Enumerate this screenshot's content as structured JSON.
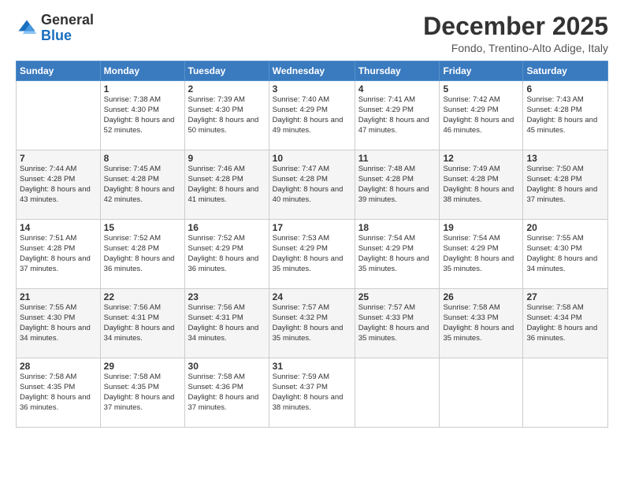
{
  "logo": {
    "general": "General",
    "blue": "Blue"
  },
  "header": {
    "month": "December 2025",
    "location": "Fondo, Trentino-Alto Adige, Italy"
  },
  "days_of_week": [
    "Sunday",
    "Monday",
    "Tuesday",
    "Wednesday",
    "Thursday",
    "Friday",
    "Saturday"
  ],
  "weeks": [
    [
      {
        "day": "",
        "sunrise": "",
        "sunset": "",
        "daylight": ""
      },
      {
        "day": "1",
        "sunrise": "Sunrise: 7:38 AM",
        "sunset": "Sunset: 4:30 PM",
        "daylight": "Daylight: 8 hours and 52 minutes."
      },
      {
        "day": "2",
        "sunrise": "Sunrise: 7:39 AM",
        "sunset": "Sunset: 4:30 PM",
        "daylight": "Daylight: 8 hours and 50 minutes."
      },
      {
        "day": "3",
        "sunrise": "Sunrise: 7:40 AM",
        "sunset": "Sunset: 4:29 PM",
        "daylight": "Daylight: 8 hours and 49 minutes."
      },
      {
        "day": "4",
        "sunrise": "Sunrise: 7:41 AM",
        "sunset": "Sunset: 4:29 PM",
        "daylight": "Daylight: 8 hours and 47 minutes."
      },
      {
        "day": "5",
        "sunrise": "Sunrise: 7:42 AM",
        "sunset": "Sunset: 4:29 PM",
        "daylight": "Daylight: 8 hours and 46 minutes."
      },
      {
        "day": "6",
        "sunrise": "Sunrise: 7:43 AM",
        "sunset": "Sunset: 4:28 PM",
        "daylight": "Daylight: 8 hours and 45 minutes."
      }
    ],
    [
      {
        "day": "7",
        "sunrise": "Sunrise: 7:44 AM",
        "sunset": "Sunset: 4:28 PM",
        "daylight": "Daylight: 8 hours and 43 minutes."
      },
      {
        "day": "8",
        "sunrise": "Sunrise: 7:45 AM",
        "sunset": "Sunset: 4:28 PM",
        "daylight": "Daylight: 8 hours and 42 minutes."
      },
      {
        "day": "9",
        "sunrise": "Sunrise: 7:46 AM",
        "sunset": "Sunset: 4:28 PM",
        "daylight": "Daylight: 8 hours and 41 minutes."
      },
      {
        "day": "10",
        "sunrise": "Sunrise: 7:47 AM",
        "sunset": "Sunset: 4:28 PM",
        "daylight": "Daylight: 8 hours and 40 minutes."
      },
      {
        "day": "11",
        "sunrise": "Sunrise: 7:48 AM",
        "sunset": "Sunset: 4:28 PM",
        "daylight": "Daylight: 8 hours and 39 minutes."
      },
      {
        "day": "12",
        "sunrise": "Sunrise: 7:49 AM",
        "sunset": "Sunset: 4:28 PM",
        "daylight": "Daylight: 8 hours and 38 minutes."
      },
      {
        "day": "13",
        "sunrise": "Sunrise: 7:50 AM",
        "sunset": "Sunset: 4:28 PM",
        "daylight": "Daylight: 8 hours and 37 minutes."
      }
    ],
    [
      {
        "day": "14",
        "sunrise": "Sunrise: 7:51 AM",
        "sunset": "Sunset: 4:28 PM",
        "daylight": "Daylight: 8 hours and 37 minutes."
      },
      {
        "day": "15",
        "sunrise": "Sunrise: 7:52 AM",
        "sunset": "Sunset: 4:28 PM",
        "daylight": "Daylight: 8 hours and 36 minutes."
      },
      {
        "day": "16",
        "sunrise": "Sunrise: 7:52 AM",
        "sunset": "Sunset: 4:29 PM",
        "daylight": "Daylight: 8 hours and 36 minutes."
      },
      {
        "day": "17",
        "sunrise": "Sunrise: 7:53 AM",
        "sunset": "Sunset: 4:29 PM",
        "daylight": "Daylight: 8 hours and 35 minutes."
      },
      {
        "day": "18",
        "sunrise": "Sunrise: 7:54 AM",
        "sunset": "Sunset: 4:29 PM",
        "daylight": "Daylight: 8 hours and 35 minutes."
      },
      {
        "day": "19",
        "sunrise": "Sunrise: 7:54 AM",
        "sunset": "Sunset: 4:29 PM",
        "daylight": "Daylight: 8 hours and 35 minutes."
      },
      {
        "day": "20",
        "sunrise": "Sunrise: 7:55 AM",
        "sunset": "Sunset: 4:30 PM",
        "daylight": "Daylight: 8 hours and 34 minutes."
      }
    ],
    [
      {
        "day": "21",
        "sunrise": "Sunrise: 7:55 AM",
        "sunset": "Sunset: 4:30 PM",
        "daylight": "Daylight: 8 hours and 34 minutes."
      },
      {
        "day": "22",
        "sunrise": "Sunrise: 7:56 AM",
        "sunset": "Sunset: 4:31 PM",
        "daylight": "Daylight: 8 hours and 34 minutes."
      },
      {
        "day": "23",
        "sunrise": "Sunrise: 7:56 AM",
        "sunset": "Sunset: 4:31 PM",
        "daylight": "Daylight: 8 hours and 34 minutes."
      },
      {
        "day": "24",
        "sunrise": "Sunrise: 7:57 AM",
        "sunset": "Sunset: 4:32 PM",
        "daylight": "Daylight: 8 hours and 35 minutes."
      },
      {
        "day": "25",
        "sunrise": "Sunrise: 7:57 AM",
        "sunset": "Sunset: 4:33 PM",
        "daylight": "Daylight: 8 hours and 35 minutes."
      },
      {
        "day": "26",
        "sunrise": "Sunrise: 7:58 AM",
        "sunset": "Sunset: 4:33 PM",
        "daylight": "Daylight: 8 hours and 35 minutes."
      },
      {
        "day": "27",
        "sunrise": "Sunrise: 7:58 AM",
        "sunset": "Sunset: 4:34 PM",
        "daylight": "Daylight: 8 hours and 36 minutes."
      }
    ],
    [
      {
        "day": "28",
        "sunrise": "Sunrise: 7:58 AM",
        "sunset": "Sunset: 4:35 PM",
        "daylight": "Daylight: 8 hours and 36 minutes."
      },
      {
        "day": "29",
        "sunrise": "Sunrise: 7:58 AM",
        "sunset": "Sunset: 4:35 PM",
        "daylight": "Daylight: 8 hours and 37 minutes."
      },
      {
        "day": "30",
        "sunrise": "Sunrise: 7:58 AM",
        "sunset": "Sunset: 4:36 PM",
        "daylight": "Daylight: 8 hours and 37 minutes."
      },
      {
        "day": "31",
        "sunrise": "Sunrise: 7:59 AM",
        "sunset": "Sunset: 4:37 PM",
        "daylight": "Daylight: 8 hours and 38 minutes."
      },
      {
        "day": "",
        "sunrise": "",
        "sunset": "",
        "daylight": ""
      },
      {
        "day": "",
        "sunrise": "",
        "sunset": "",
        "daylight": ""
      },
      {
        "day": "",
        "sunrise": "",
        "sunset": "",
        "daylight": ""
      }
    ]
  ]
}
